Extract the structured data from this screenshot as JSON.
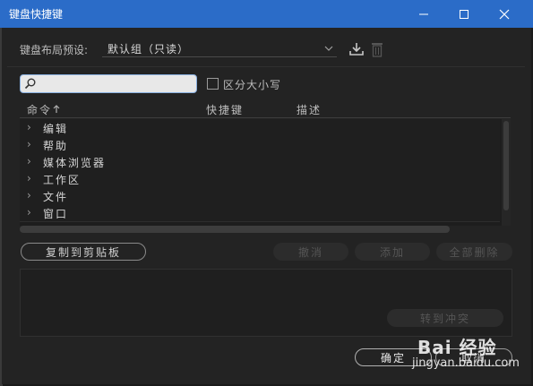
{
  "window": {
    "title": "键盘快捷键",
    "minimize_icon": "minimize-icon",
    "maximize_icon": "maximize-icon",
    "close_icon": "close-icon",
    "titlebar_color": "#2b6cc8"
  },
  "preset": {
    "label": "键盘布局预设:",
    "value": "默认组（只读）"
  },
  "search": {
    "value": "",
    "placeholder": ""
  },
  "case_checkbox": {
    "label": "区分大小写",
    "checked": false
  },
  "table": {
    "headers": {
      "command": "命令",
      "shortcut": "快捷键",
      "description": "描述"
    },
    "rows": [
      {
        "label": "编辑"
      },
      {
        "label": "帮助"
      },
      {
        "label": "媒体浏览器"
      },
      {
        "label": "工作区"
      },
      {
        "label": "文件"
      },
      {
        "label": "窗口"
      }
    ]
  },
  "buttons": {
    "copy": "复制到剪贴板",
    "undo": "撤消",
    "add": "添加",
    "delete_all": "全部删除",
    "goto_conflict": "转到冲突",
    "ok": "确定",
    "cancel": "取消"
  },
  "watermark": {
    "brand": "Bai 经验",
    "url": "jingyan.baidu.com"
  }
}
